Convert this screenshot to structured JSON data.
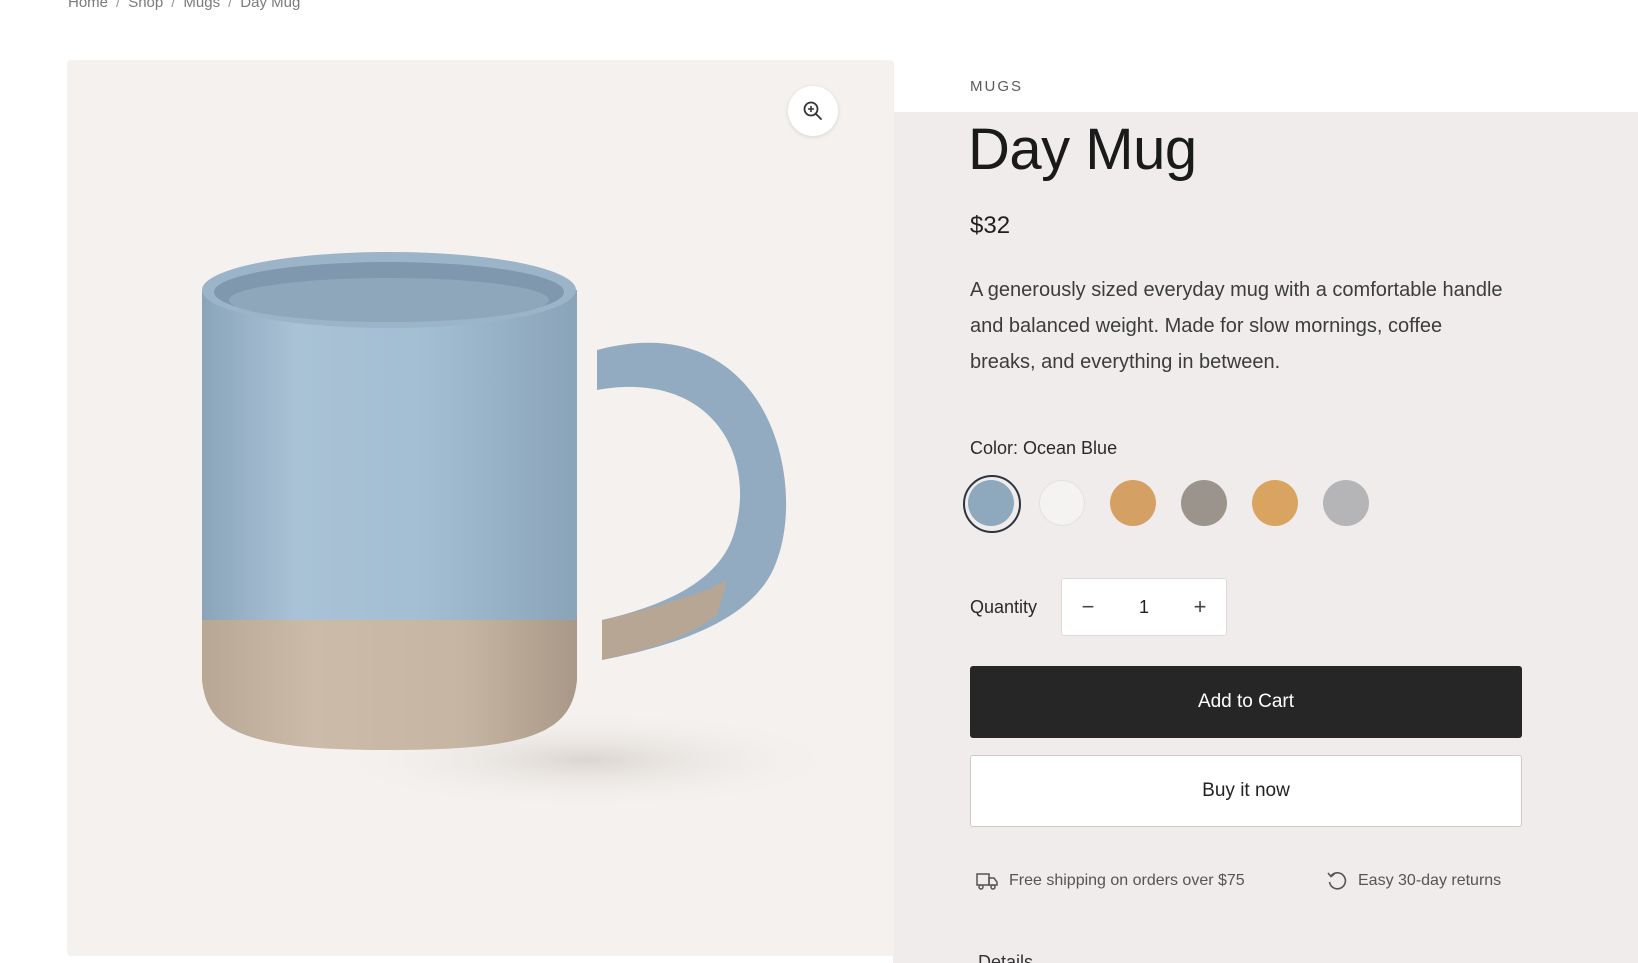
{
  "breadcrumb": {
    "items": [
      "Home",
      "Shop",
      "Mugs",
      "Day Mug"
    ],
    "separator": "/"
  },
  "product": {
    "category": "MUGS",
    "title": "Day Mug",
    "price": "$32",
    "description": "A generously sized everyday mug with a comfortable handle and balanced weight. Made for slow mornings, coffee breaks, and everything in between.",
    "color_label": "Color: Ocean Blue",
    "swatches": [
      {
        "name": "Ocean Blue",
        "color": "#8ea8bd",
        "selected": true
      },
      {
        "name": "White",
        "color": "#f5f3f1",
        "selected": false
      },
      {
        "name": "Ochre",
        "color": "#d4a064",
        "selected": false
      },
      {
        "name": "Stone",
        "color": "#9b948c",
        "selected": false
      },
      {
        "name": "Amber",
        "color": "#d9a45f",
        "selected": false
      },
      {
        "name": "Grey",
        "color": "#b5b5b8",
        "selected": false
      }
    ]
  },
  "quantity": {
    "label": "Quantity",
    "value": "1",
    "decrement": "−",
    "increment": "+"
  },
  "actions": {
    "add_to_cart": "Add to Cart",
    "buy_now": "Buy it now"
  },
  "perks": {
    "shipping": "Free shipping on orders over $75",
    "returns": "Easy 30-day returns"
  },
  "details_peek": "Details",
  "icons": {
    "zoom": "zoom-in-icon",
    "shipping": "truck-icon",
    "returns": "refresh-icon"
  },
  "colors": {
    "accent_button": "#262626",
    "panel_bg": "#efeceb",
    "image_bg": "#f4f1ef"
  }
}
